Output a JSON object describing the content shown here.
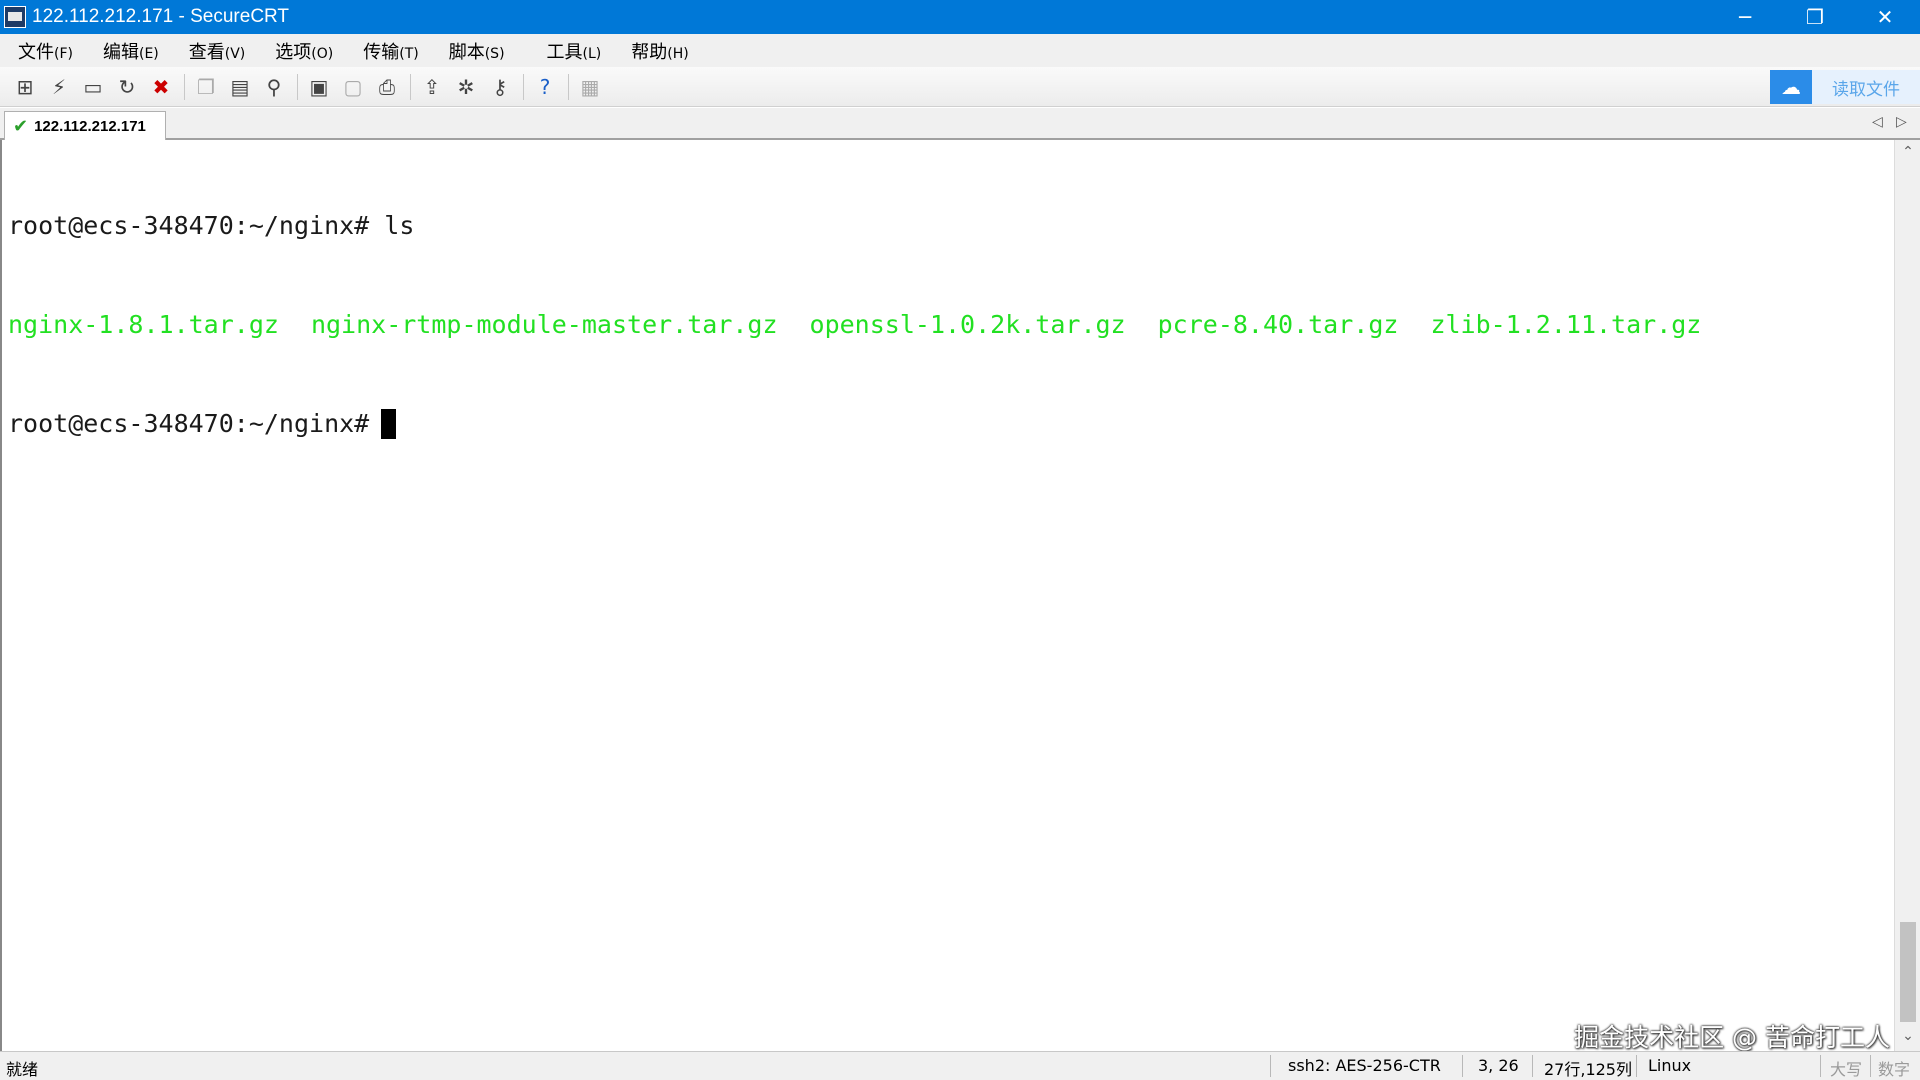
{
  "window": {
    "title": "122.112.212.171 - SecureCRT",
    "minimize_glyph": "─",
    "maximize_glyph": "❐",
    "close_glyph": "✕"
  },
  "menu": [
    {
      "label": "文件",
      "key": "(F)"
    },
    {
      "label": "编辑",
      "key": "(E)"
    },
    {
      "label": "查看",
      "key": "(V)"
    },
    {
      "label": "选项",
      "key": "(O)"
    },
    {
      "label": "传输",
      "key": "(T)"
    },
    {
      "label": "脚本",
      "key": "(S)"
    },
    {
      "label": "工具",
      "key": "(L)"
    },
    {
      "label": "帮助",
      "key": "(H)"
    }
  ],
  "toolbar": {
    "icons": [
      "connect-icon",
      "quick-connect-icon",
      "connect-tab-icon",
      "reconnect-icon",
      "disconnect-icon",
      "copy-icon",
      "paste-icon",
      "find-icon",
      "print-screen-icon",
      "print-selection-icon",
      "print-icon",
      "sftp-icon",
      "session-options-icon",
      "keymap-icon",
      "help-icon",
      "script-icon"
    ],
    "cloud_label": "读取文件",
    "cloud_color": "#2b8ce8"
  },
  "tab": {
    "label": "122.112.212.171",
    "status": "connected"
  },
  "terminal": {
    "line1": "root@ecs-348470:~/nginx# ls",
    "files": [
      "nginx-1.8.1.tar.gz",
      "nginx-rtmp-module-master.tar.gz",
      "openssl-1.0.2k.tar.gz",
      "pcre-8.40.tar.gz",
      "zlib-1.2.11.tar.gz"
    ],
    "prompt": "root@ecs-348470:~/nginx#",
    "file_color": "#22e022"
  },
  "watermark": "掘金技术社区 @ 苦命打工人",
  "status": {
    "ready": "就绪",
    "cipher": "ssh2: AES-256-CTR",
    "position": "3,  26",
    "size": "27行,125列",
    "term_type": "Linux",
    "caps": "大写",
    "num": "数字"
  }
}
